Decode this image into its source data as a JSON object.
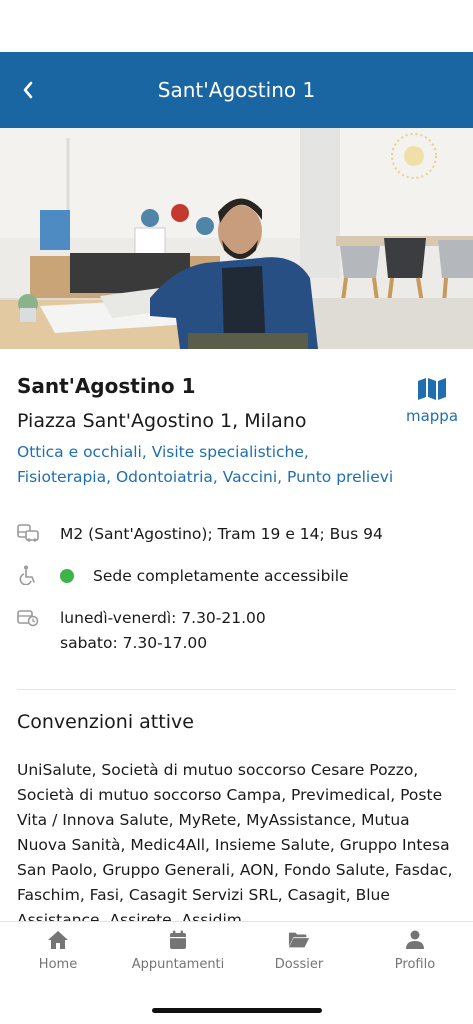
{
  "header": {
    "title": "Sant'Agostino 1"
  },
  "location": {
    "name": "Sant'Agostino 1",
    "address": "Piazza Sant'Agostino 1, Milano",
    "services": "Ottica e occhiali, Visite specialistiche, Fisioterapia, Odontoiatria, Vaccini, Punto prelievi",
    "map_label": "mappa"
  },
  "info": {
    "transport": "M2 (Sant'Agostino); Tram 19 e 14; Bus 94",
    "accessibility": "Sede completamente accessibile",
    "hours_weekdays": "lunedì-venerdì: 7.30-21.00",
    "hours_saturday": "sabato: 7.30-17.00"
  },
  "conventions": {
    "title": "Convenzioni attive",
    "text": "UniSalute, Società di mutuo soccorso Cesare Pozzo, Società di mutuo soccorso Campa, Previmedical, Poste Vita / Innova Salute, MyRete, MyAssistance, Mutua Nuova Sanità, Medic4All, Insieme Salute, Gruppo Intesa San Paolo, Gruppo Generali, AON, Fondo Salute, Fasdac, Faschim, Fasi, Casagit Servizi SRL, Casagit, Blue Assistance, Assirete, Assidim"
  },
  "tabs": [
    {
      "label": "Home",
      "icon": "home-icon"
    },
    {
      "label": "Appuntamenti",
      "icon": "calendar-icon"
    },
    {
      "label": "Dossier",
      "icon": "folder-icon"
    },
    {
      "label": "Profilo",
      "icon": "user-icon"
    }
  ],
  "colors": {
    "header_bg": "#1966a3",
    "link": "#1f6fb0",
    "accessible_dot": "#3cb44b",
    "tab_inactive": "#757575"
  }
}
